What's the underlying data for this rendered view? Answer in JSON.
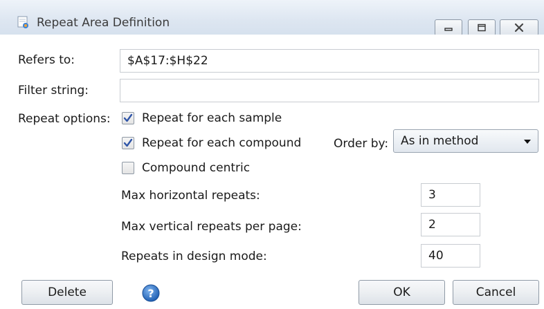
{
  "window": {
    "title": "Repeat Area Definition"
  },
  "fields": {
    "refers_to": {
      "label": "Refers to:",
      "value": "$A$17:$H$22"
    },
    "filter_string": {
      "label": "Filter string:",
      "value": ""
    }
  },
  "repeat_options": {
    "label": "Repeat options:",
    "each_sample": {
      "label": "Repeat for each sample",
      "checked": true
    },
    "each_compound": {
      "label": "Repeat for each compound",
      "checked": true
    },
    "compound_centric": {
      "label": "Compound centric",
      "checked": false
    },
    "order_by": {
      "label": "Order by:",
      "value": "As in method"
    }
  },
  "limits": {
    "max_horizontal": {
      "label": "Max horizontal repeats:",
      "value": "3"
    },
    "max_vertical": {
      "label": "Max vertical repeats per page:",
      "value": "2"
    },
    "design_mode": {
      "label": "Repeats in design mode:",
      "value": "40"
    }
  },
  "buttons": {
    "delete": "Delete",
    "ok": "OK",
    "cancel": "Cancel"
  },
  "icons": {
    "app": "repeat-area-icon",
    "minimize": "minimize-icon",
    "maximize": "maximize-icon",
    "close": "close-icon",
    "help": "help-icon",
    "dropdown": "chevron-down-icon",
    "check": "checkmark-icon"
  },
  "colors": {
    "accent": "#2f6bb8",
    "titlebar": "#dde6f1"
  }
}
